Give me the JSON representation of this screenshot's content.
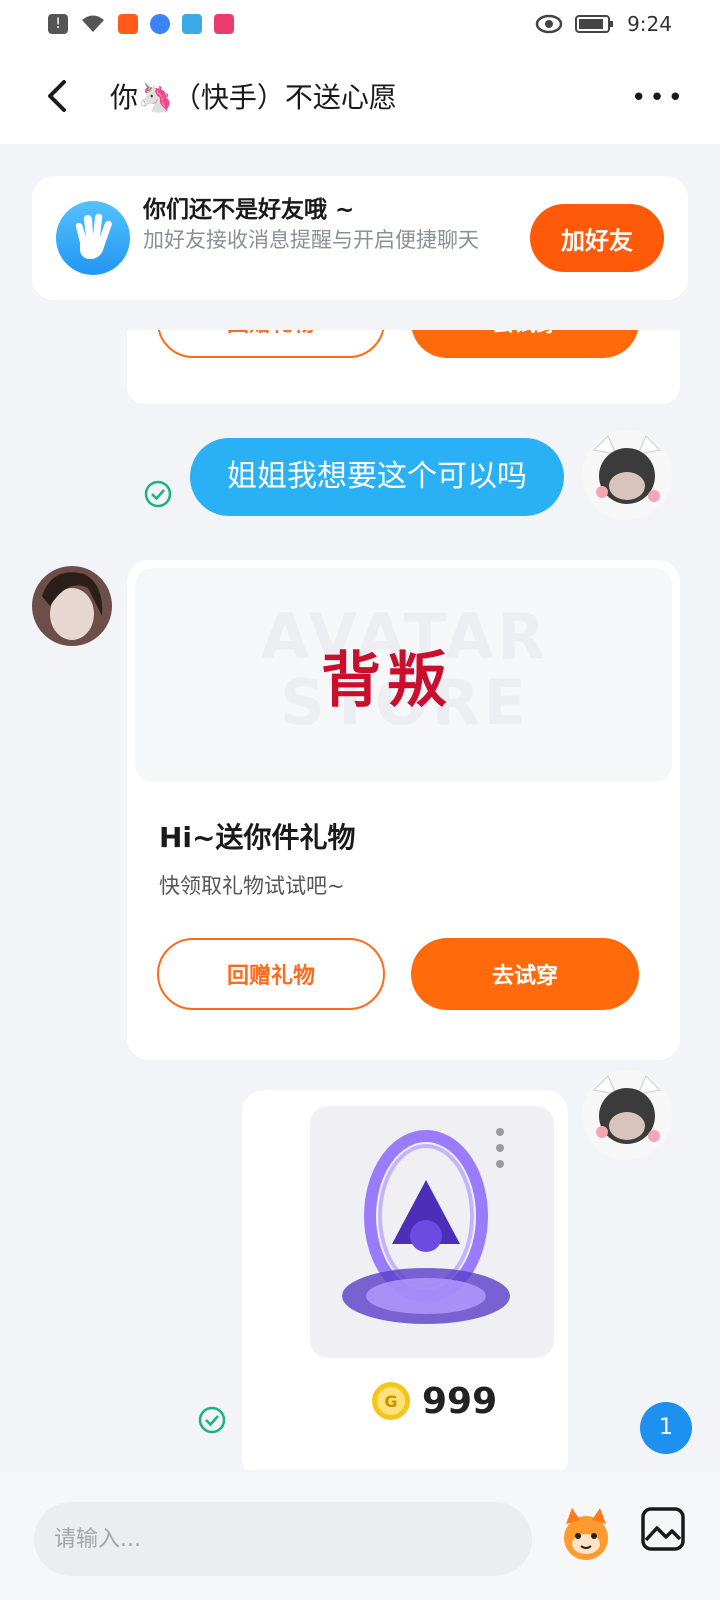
{
  "status_bar": {
    "time": "9:24"
  },
  "header": {
    "title": "你🦄（快手）不送心愿"
  },
  "friend_notice": {
    "title": "你们还不是好友哦 ~",
    "description": "加好友接收消息提醒与开启便捷聊天",
    "add_button": "加好友"
  },
  "messages": {
    "partial_card": {
      "return_gift": "回赠礼物",
      "try_on": "去试穿"
    },
    "text_bubble": "姐姐我想要这个可以吗",
    "gift_card": {
      "banner_text": "背叛",
      "banner_watermark": "AVATAR STORE",
      "title": "Hi~送你件礼物",
      "subtitle": "快领取礼物试试吧~",
      "return_gift": "回赠礼物",
      "try_on": "去试穿"
    },
    "item_card": {
      "price": "999"
    }
  },
  "unread_count": "1",
  "composer": {
    "placeholder": "请输入..."
  },
  "colors": {
    "accent_orange": "#ff6a0a",
    "bubble_blue": "#2ab0f5",
    "read_green": "#19b37b"
  }
}
